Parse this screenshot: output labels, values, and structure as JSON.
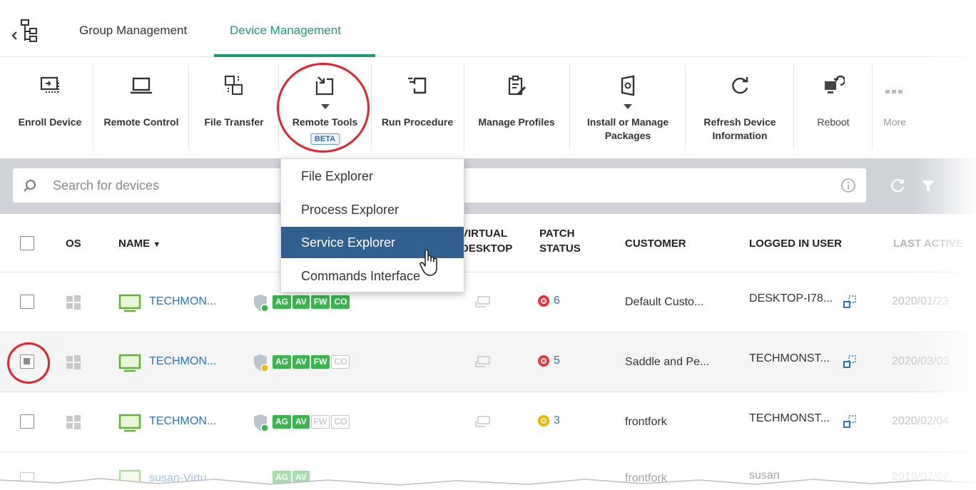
{
  "tabs": {
    "group": "Group Management",
    "device": "Device Management"
  },
  "toolbar": {
    "enroll": "Enroll Device",
    "remote_control": "Remote Control",
    "file_transfer": "File Transfer",
    "remote_tools": "Remote Tools",
    "beta": "BETA",
    "run_procedure": "Run Procedure",
    "manage_profiles": "Manage Profiles",
    "install_manage_1": "Install or Manage",
    "install_manage_2": "Packages",
    "refresh_1": "Refresh Device",
    "refresh_2": "Information",
    "reboot": "Reboot",
    "more": "More"
  },
  "search": {
    "placeholder": "Search for devices"
  },
  "dropdown": {
    "items": [
      "File Explorer",
      "Process Explorer",
      "Service Explorer",
      "Commands Interface"
    ]
  },
  "table": {
    "headers": {
      "os": "OS",
      "name": "NAME",
      "virtual_1": "VIRTUAL",
      "virtual_2": "DESKTOP",
      "patch_1": "PATCH",
      "patch_2": "STATUS",
      "customer": "CUSTOMER",
      "logged_in": "LOGGED IN USER",
      "last_active": "LAST ACTIVE"
    },
    "rows": [
      {
        "name": "TECHMON...",
        "badges": [
          "AG",
          "AV",
          "FW",
          "CO"
        ],
        "patch": "6",
        "customer": "Default Custo...",
        "user": "DESKTOP-I78...",
        "last_active": "2020/01/23"
      },
      {
        "name": "TECHMON...",
        "badges": [
          "AG",
          "AV",
          "FW",
          "CO"
        ],
        "patch": "5",
        "customer": "Saddle and Pe...",
        "user": "TECHMONST...",
        "last_active": "2020/03/03"
      },
      {
        "name": "TECHMON...",
        "badges": [
          "AG",
          "AV",
          "FW",
          "CO"
        ],
        "patch": "3",
        "customer": "frontfork",
        "user": "TECHMONST...",
        "last_active": "2020/02/04"
      },
      {
        "name": "susan-Virtu...",
        "badges": [
          "AG",
          "AV"
        ],
        "customer": "frontfork",
        "user": "susan",
        "last_active": "2019/07/07"
      }
    ]
  },
  "colors": {
    "accent": "#1b9a78",
    "link": "#2a74c0",
    "highlight": "#315f8f",
    "badge_on": "#3ab54a",
    "annotation_ring": "#e8202a"
  }
}
